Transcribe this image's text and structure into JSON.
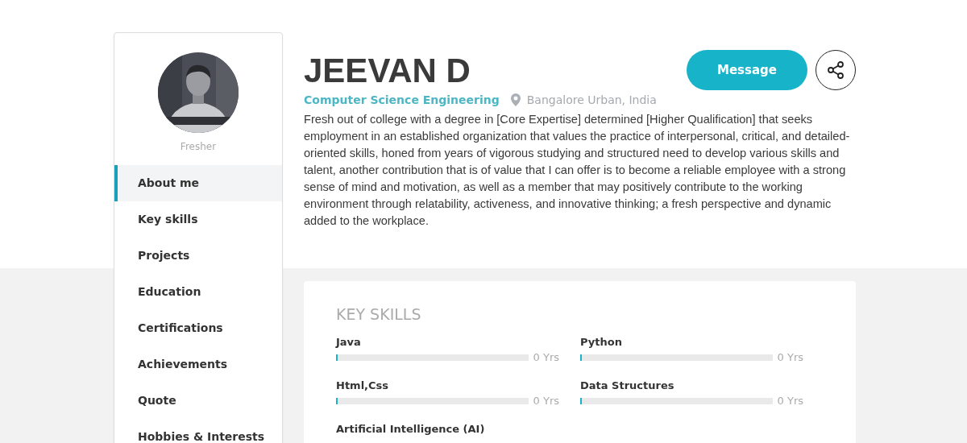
{
  "profile": {
    "name": "JEEVAN D",
    "status": "Fresher",
    "field": "Computer Science Engineering",
    "location": "Bangalore Urban, India",
    "bio": "Fresh out of college with a degree in [Core Expertise] determined [Higher Qualification] that seeks employment in an established organization that values the practice of interpersonal, critical, and detailed-oriented skills, honed from years of vigorous studying and structured need to develop various skills and talent, another contribution that is of value that I can offer is to become a reliable employee with a strong sense of mind and motivation, as well as a member that may positively contribute to the working environment through relatability, activeness, and innovative thinking; a fresh perspective and dynamic added to the workplace."
  },
  "actions": {
    "message": "Message"
  },
  "sidebar": {
    "items": [
      {
        "label": "About me",
        "selected": true
      },
      {
        "label": "Key skills",
        "selected": false
      },
      {
        "label": "Projects",
        "selected": false
      },
      {
        "label": "Education",
        "selected": false
      },
      {
        "label": "Certifications",
        "selected": false
      },
      {
        "label": "Achievements",
        "selected": false
      },
      {
        "label": "Quote",
        "selected": false
      },
      {
        "label": "Hobbies & Interests",
        "selected": false
      }
    ]
  },
  "key_skills": {
    "title": "KEY SKILLS",
    "skills": [
      {
        "name": "Java",
        "level": 0,
        "reading": "0 Yrs"
      },
      {
        "name": "Python",
        "level": 0,
        "reading": "0 Yrs"
      },
      {
        "name": "Html,Css",
        "level": 0,
        "reading": "0 Yrs"
      },
      {
        "name": "Data Structures",
        "level": 0,
        "reading": "0 Yrs"
      },
      {
        "name": "Artificial Intelligence (AI)"
      }
    ]
  }
}
